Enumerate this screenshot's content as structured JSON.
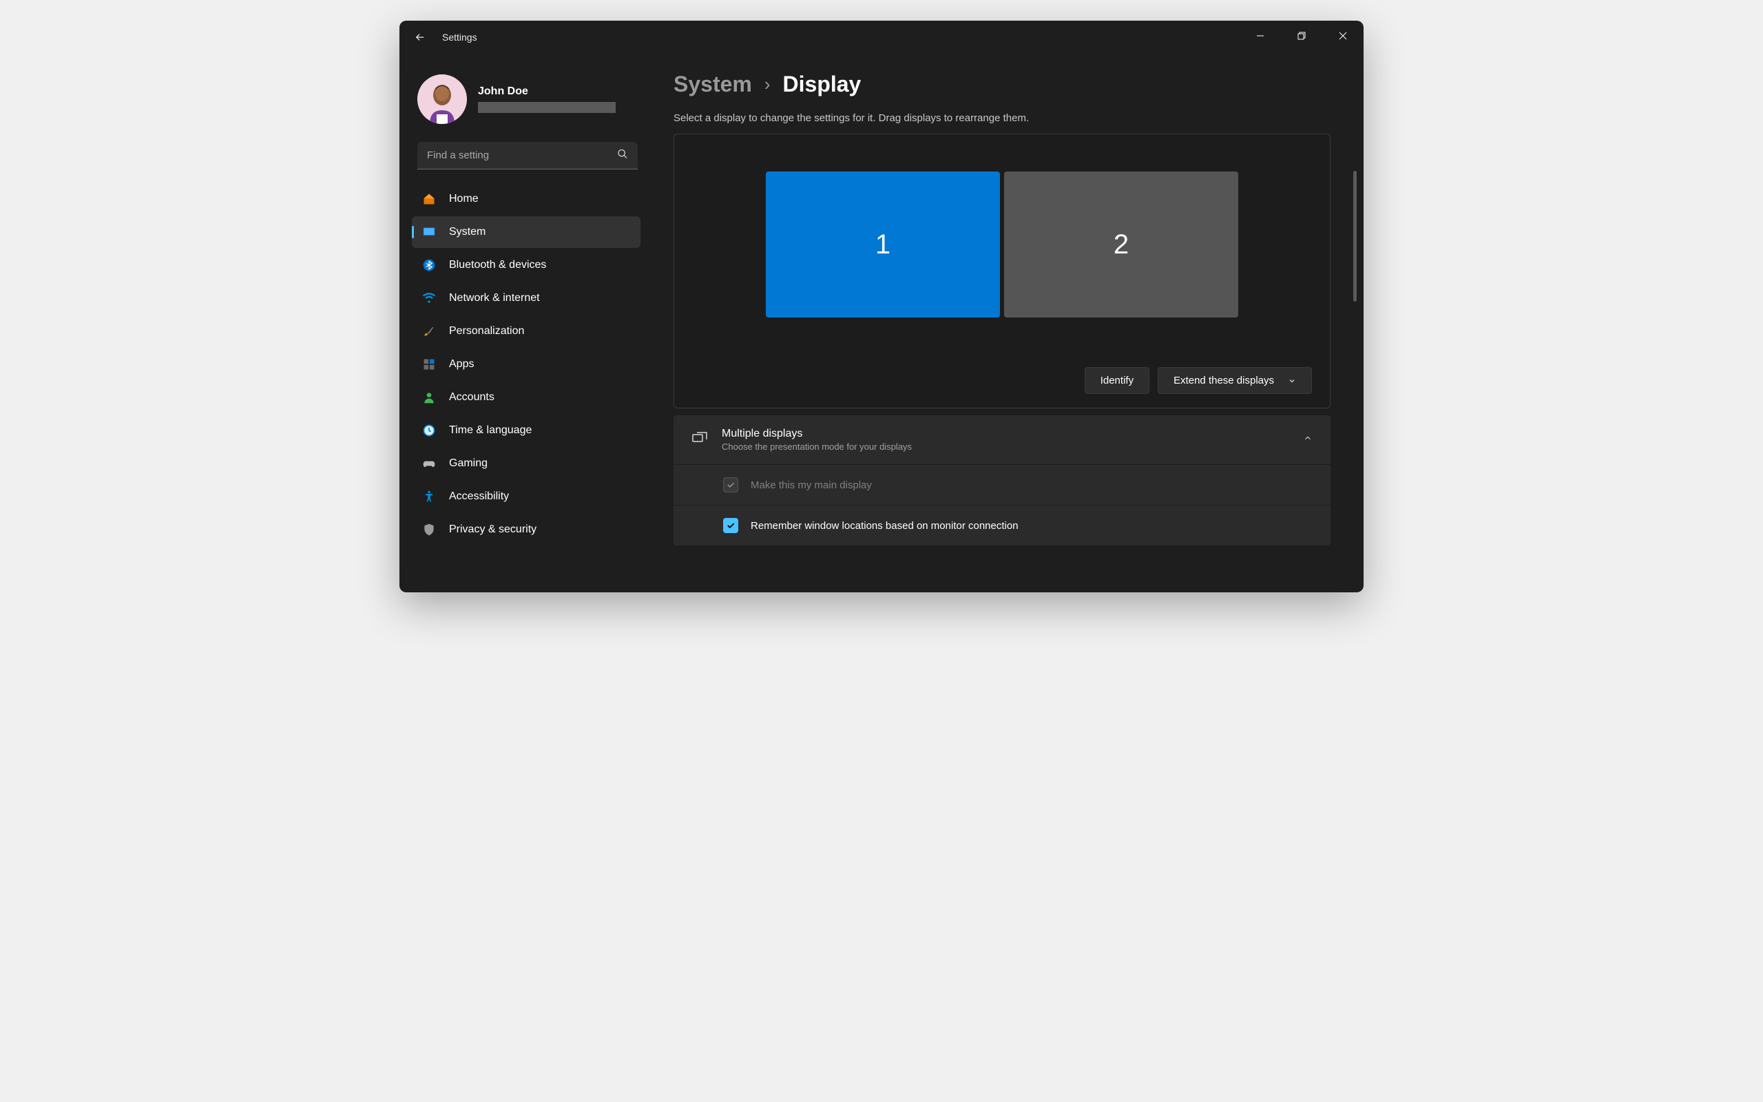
{
  "titlebar": {
    "title": "Settings"
  },
  "profile": {
    "name": "John Doe"
  },
  "search": {
    "placeholder": "Find a setting"
  },
  "nav": {
    "items": [
      {
        "label": "Home"
      },
      {
        "label": "System"
      },
      {
        "label": "Bluetooth & devices"
      },
      {
        "label": "Network & internet"
      },
      {
        "label": "Personalization"
      },
      {
        "label": "Apps"
      },
      {
        "label": "Accounts"
      },
      {
        "label": "Time & language"
      },
      {
        "label": "Gaming"
      },
      {
        "label": "Accessibility"
      },
      {
        "label": "Privacy & security"
      }
    ]
  },
  "breadcrumb": {
    "parent": "System",
    "separator": "›",
    "current": "Display"
  },
  "instruction": "Select a display to change the settings for it. Drag displays to rearrange them.",
  "displays": {
    "d1": "1",
    "d2": "2"
  },
  "actions": {
    "identify": "Identify",
    "extend": "Extend these displays"
  },
  "expander": {
    "title": "Multiple displays",
    "subtitle": "Choose the presentation mode for your displays",
    "options": [
      {
        "label": "Make this my main display"
      },
      {
        "label": "Remember window locations based on monitor connection"
      }
    ]
  }
}
